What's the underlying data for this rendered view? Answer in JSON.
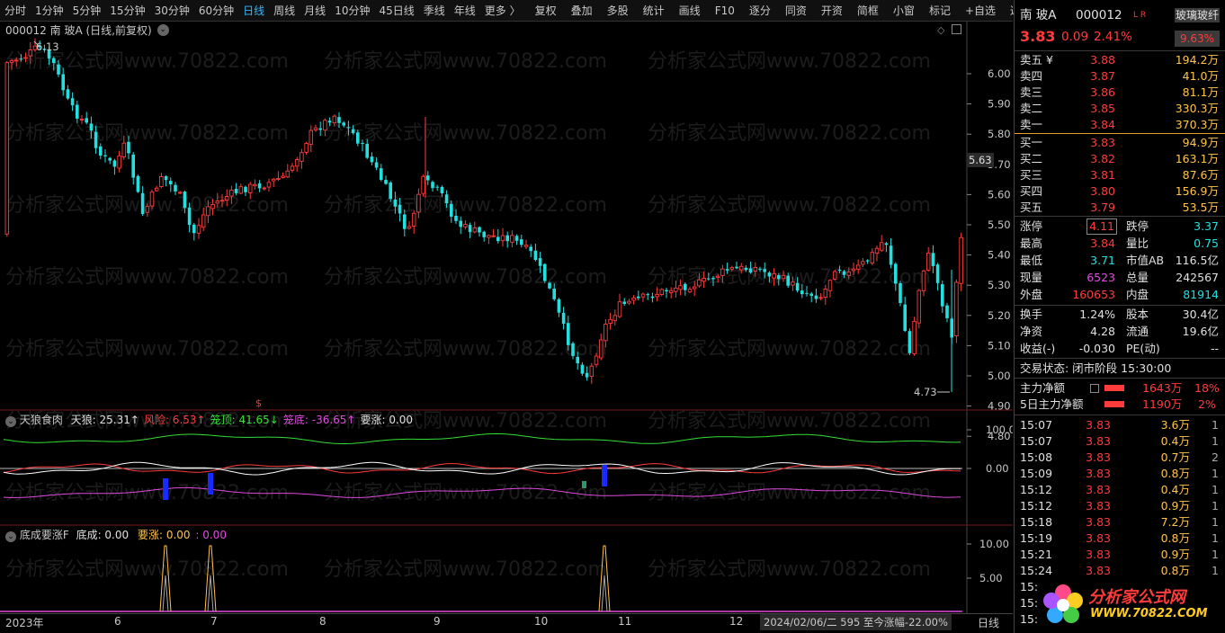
{
  "toolbar": {
    "items": [
      "分时",
      "1分钟",
      "5分钟",
      "15分钟",
      "30分钟",
      "60分钟",
      "日线",
      "周线",
      "月线",
      "10分钟",
      "45日线",
      "季线",
      "年线",
      "更多 〉"
    ],
    "active_index": 6,
    "actions": [
      "复权",
      "叠加",
      "多股",
      "统计",
      "画线",
      "F10",
      "逐分",
      "同资",
      "开资",
      "简框",
      "小窗",
      "标记",
      "+自选",
      "返回"
    ]
  },
  "main": {
    "title": "000012 南 玻A (日线,前复权)",
    "high_marker": "6.13",
    "low_marker": "4.73",
    "last_price_tag": "5.63",
    "y_ticks": [
      "6.00",
      "5.90",
      "5.80",
      "5.70",
      "5.60",
      "5.50",
      "5.40",
      "5.30",
      "5.20",
      "5.10",
      "5.00",
      "4.90",
      "4.80"
    ],
    "watermark": "分析家公式网www.70822.com",
    "signal_glyph": "$"
  },
  "indicator1": {
    "name": "天狼食肉",
    "values": [
      {
        "label": "天狼: 25.31",
        "arrow": "↑",
        "color": "#e0e0e0"
      },
      {
        "label": "风险: 6.53",
        "arrow": "↑",
        "color": "#ff3b3b"
      },
      {
        "label": "笼顶: 41.65",
        "arrow": "↓",
        "color": "#33e033"
      },
      {
        "label": "笼底: -36.65",
        "arrow": "↑",
        "color": "#e04ae0"
      },
      {
        "label": "要涨: 0.00",
        "arrow": "",
        "color": "#e0e0e0"
      }
    ],
    "y_ticks": [
      "100.0",
      "0.00"
    ]
  },
  "indicator2": {
    "name": "底成要涨F",
    "v1": "底成: 0.00",
    "v2": "要涨: 0.00",
    "v3": ": 0.00",
    "y_ticks": [
      "10.00",
      "5.00"
    ]
  },
  "x_axis": {
    "labels": [
      "2023年",
      "6",
      "7",
      "8",
      "9",
      "10",
      "11",
      "12"
    ],
    "cursor_info": "2024/02/06/二 595 至今涨幅-22.00%",
    "period": "日线"
  },
  "quote": {
    "name": "南 玻A",
    "code": "000012",
    "flags": "L R",
    "sector": "玻璃玻纤",
    "price": "3.83",
    "change": "0.09",
    "change_pct": "2.41%",
    "sector_pct": "9.63%",
    "asks": [
      {
        "label": "卖五 ¥",
        "price": "3.88",
        "vol": "194.2万"
      },
      {
        "label": "卖四",
        "price": "3.87",
        "vol": "41.0万"
      },
      {
        "label": "卖三",
        "price": "3.86",
        "vol": "81.1万"
      },
      {
        "label": "卖二",
        "price": "3.85",
        "vol": "330.3万"
      },
      {
        "label": "卖一",
        "price": "3.84",
        "vol": "370.3万"
      }
    ],
    "bids": [
      {
        "label": "买一",
        "price": "3.83",
        "vol": "94.9万"
      },
      {
        "label": "买二",
        "price": "3.82",
        "vol": "163.1万"
      },
      {
        "label": "买三",
        "price": "3.81",
        "vol": "87.6万"
      },
      {
        "label": "买四",
        "price": "3.80",
        "vol": "156.9万"
      },
      {
        "label": "买五",
        "price": "3.79",
        "vol": "53.5万"
      }
    ],
    "stats": [
      {
        "l1": "涨停",
        "v1": "4.11",
        "c1": "red",
        "l2": "跌停",
        "v2": "3.37",
        "c2": "green"
      },
      {
        "l1": "最高",
        "v1": "3.84",
        "c1": "red",
        "l2": "量比",
        "v2": "0.75",
        "c2": "green"
      },
      {
        "l1": "最低",
        "v1": "3.71",
        "c1": "green",
        "l2": "市值AB",
        "v2": "116.5亿",
        "c2": "white"
      },
      {
        "l1": "现量",
        "v1": "6523",
        "c1": "purple",
        "l2": "总量",
        "v2": "242567",
        "c2": "white"
      },
      {
        "l1": "外盘",
        "v1": "160653",
        "c1": "red",
        "l2": "内盘",
        "v2": "81914",
        "c2": "green"
      }
    ],
    "stats2": [
      {
        "l1": "换手",
        "v1": "1.24%",
        "l2": "股本",
        "v2": "30.4亿"
      },
      {
        "l1": "净资",
        "v1": "4.28",
        "l2": "流通",
        "v2": "19.6亿"
      },
      {
        "l1": "收益(-)",
        "v1": "-0.030",
        "l2": "PE(动)",
        "v2": "--"
      }
    ],
    "trade_status": "交易状态: 闭市阶段 15:30:00",
    "main_net": {
      "label": "主力净额",
      "value": "1643万",
      "pct": "18%"
    },
    "main_net5": {
      "label": "5日主力净额",
      "value": "1190万",
      "pct": "2%"
    },
    "ticks": [
      {
        "t": "15:07",
        "p": "3.83",
        "v": "3.6万",
        "n": "1"
      },
      {
        "t": "15:07",
        "p": "3.83",
        "v": "0.4万",
        "n": "1"
      },
      {
        "t": "15:08",
        "p": "3.83",
        "v": "0.7万",
        "n": "2"
      },
      {
        "t": "15:09",
        "p": "3.83",
        "v": "0.8万",
        "n": "1"
      },
      {
        "t": "15:12",
        "p": "3.83",
        "v": "0.4万",
        "n": "1"
      },
      {
        "t": "15:12",
        "p": "3.83",
        "v": "0.9万",
        "n": "1"
      },
      {
        "t": "15:18",
        "p": "3.83",
        "v": "7.2万",
        "n": "1"
      },
      {
        "t": "15:19",
        "p": "3.83",
        "v": "0.8万",
        "n": "1"
      },
      {
        "t": "15:21",
        "p": "3.83",
        "v": "0.9万",
        "n": "1"
      },
      {
        "t": "15:24",
        "p": "3.83",
        "v": "0.8万",
        "n": "1"
      },
      {
        "t": "15:",
        "p": "",
        "v": "",
        "n": ""
      },
      {
        "t": "15:",
        "p": "",
        "v": "",
        "n": ""
      },
      {
        "t": "15:",
        "p": "",
        "v": "",
        "n": ""
      }
    ],
    "logo_title": "分析家公式网",
    "logo_url": "WWW.70822.COM"
  }
}
